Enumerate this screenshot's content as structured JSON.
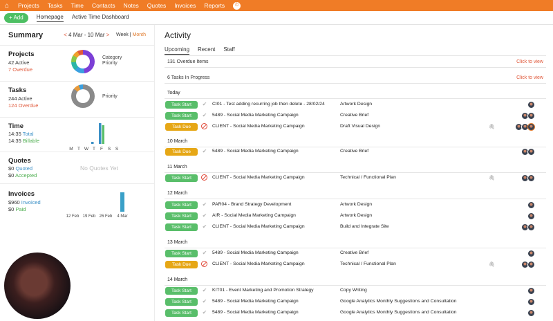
{
  "nav": {
    "items": [
      "Projects",
      "Tasks",
      "Time",
      "Contacts",
      "Notes",
      "Quotes",
      "Invoices",
      "Reports"
    ]
  },
  "subnav": {
    "add_label": "+ Add",
    "tabs": [
      "Homepage",
      "Active Time Dashboard"
    ]
  },
  "summary": {
    "title": "Summary",
    "range": "4 Mar - 10 Mar",
    "prev": "<",
    "next": ">",
    "week": "Week",
    "sep": "|",
    "month": "Month",
    "projects": {
      "label": "Projects",
      "active": "42 Active",
      "overdue": "7 Overdue",
      "chart_label1": "Category",
      "chart_label2": "Priority"
    },
    "tasks": {
      "label": "Tasks",
      "active": "244 Active",
      "overdue": "124 Overdue",
      "chart_label": "Priority"
    },
    "time": {
      "label": "Time",
      "total_value": "14:35",
      "total_word": "Total",
      "billable_value": "14:35",
      "billable_word": "Billable",
      "days": [
        "M",
        "T",
        "W",
        "T",
        "F",
        "S",
        "S"
      ]
    },
    "quotes": {
      "label": "Quotes",
      "quoted_value": "$0",
      "quoted_word": "Quoted",
      "accepted_value": "$0",
      "accepted_word": "Accepted",
      "empty": "No Quotes Yet"
    },
    "invoices": {
      "label": "Invoices",
      "invoiced_value": "$960",
      "invoiced_word": "Invoiced",
      "paid_value": "$0",
      "paid_word": "Paid",
      "weeks": [
        "12 Feb",
        "19 Feb",
        "26 Feb",
        "4 Mar"
      ]
    }
  },
  "chart_data": [
    {
      "type": "bar",
      "categories": [
        "M",
        "T",
        "W",
        "T",
        "F",
        "S",
        "S"
      ],
      "series": [
        {
          "values": [
            0,
            0,
            0,
            0.5,
            5,
            0,
            0
          ]
        },
        {
          "values": [
            0,
            0,
            0,
            0,
            4.5,
            0,
            0
          ]
        }
      ]
    },
    {
      "type": "bar",
      "categories": [
        "12 Feb",
        "19 Feb",
        "26 Feb",
        "4 Mar"
      ],
      "values": [
        0,
        0,
        0,
        960
      ]
    }
  ],
  "activity": {
    "title": "Activity",
    "tabs": [
      "Upcoming",
      "Recent",
      "Staff"
    ],
    "overdue": "131 Overdue Items",
    "in_progress": "6 Tasks In Progress",
    "click_to_view": "Click to view",
    "days": [
      "Today",
      "10 March",
      "11 March",
      "12 March",
      "13 March",
      "14 March"
    ],
    "rows": [
      {
        "status": "Task Start",
        "kind": "start",
        "icon": "check",
        "name": "CI01 - Test adding recurring job then delete - 28/02/24",
        "type": "Artwork Design",
        "clip": false,
        "avatars": 1
      },
      {
        "status": "Task Start",
        "kind": "start",
        "icon": "check",
        "name": "5489 - Social Media Marketing Campaign",
        "type": "Creative Brief",
        "clip": false,
        "avatars": 2
      },
      {
        "status": "Task Due",
        "kind": "due",
        "icon": "stop",
        "name": "CLIENT - Social Media Marketing Campaign",
        "type": "Draft Visual Design",
        "clip": true,
        "avatars": 3
      },
      {
        "status": "Task Due",
        "kind": "due",
        "icon": "check",
        "name": "5489 - Social Media Marketing Campaign",
        "type": "Creative Brief",
        "clip": false,
        "avatars": 2
      },
      {
        "status": "Task Start",
        "kind": "start",
        "icon": "stop",
        "name": "CLIENT - Social Media Marketing Campaign",
        "type": "Technical / Functional Plan",
        "clip": true,
        "avatars": 2
      },
      {
        "status": "Task Start",
        "kind": "start",
        "icon": "check",
        "name": "PAR04 - Brand Strategy Development",
        "type": "Artwork Design",
        "clip": false,
        "avatars": 1
      },
      {
        "status": "Task Start",
        "kind": "start",
        "icon": "check",
        "name": "AIR - Social Media Marketing Campaign",
        "type": "Artwork Design",
        "clip": false,
        "avatars": 1
      },
      {
        "status": "Task Start",
        "kind": "start",
        "icon": "check",
        "name": "CLIENT - Social Media Marketing Campaign",
        "type": "Build and Integrate Site",
        "clip": false,
        "avatars": 2
      },
      {
        "status": "Task Start",
        "kind": "start",
        "icon": "check",
        "name": "5489 - Social Media Marketing Campaign",
        "type": "Creative Brief",
        "clip": false,
        "avatars": 1
      },
      {
        "status": "Task Due",
        "kind": "due",
        "icon": "stop",
        "name": "CLIENT - Social Media Marketing Campaign",
        "type": "Technical / Functional Plan",
        "clip": true,
        "avatars": 2
      },
      {
        "status": "Task Start",
        "kind": "start",
        "icon": "check",
        "name": "KIT01 - Event Marketing and Promotion Strategy",
        "type": "Copy Writing",
        "clip": false,
        "avatars": 1
      },
      {
        "status": "Task Start",
        "kind": "start",
        "icon": "check",
        "name": "5489 - Social Media Marketing Campaign",
        "type": "Google Analytics Monthly Suggestions and Consultation",
        "clip": false,
        "avatars": 1
      },
      {
        "status": "Task Start",
        "kind": "start",
        "icon": "check",
        "name": "5489 - Social Media Marketing Campaign",
        "type": "Google Analytics Monthly Suggestions and Consultation",
        "clip": false,
        "avatars": 1
      }
    ]
  }
}
